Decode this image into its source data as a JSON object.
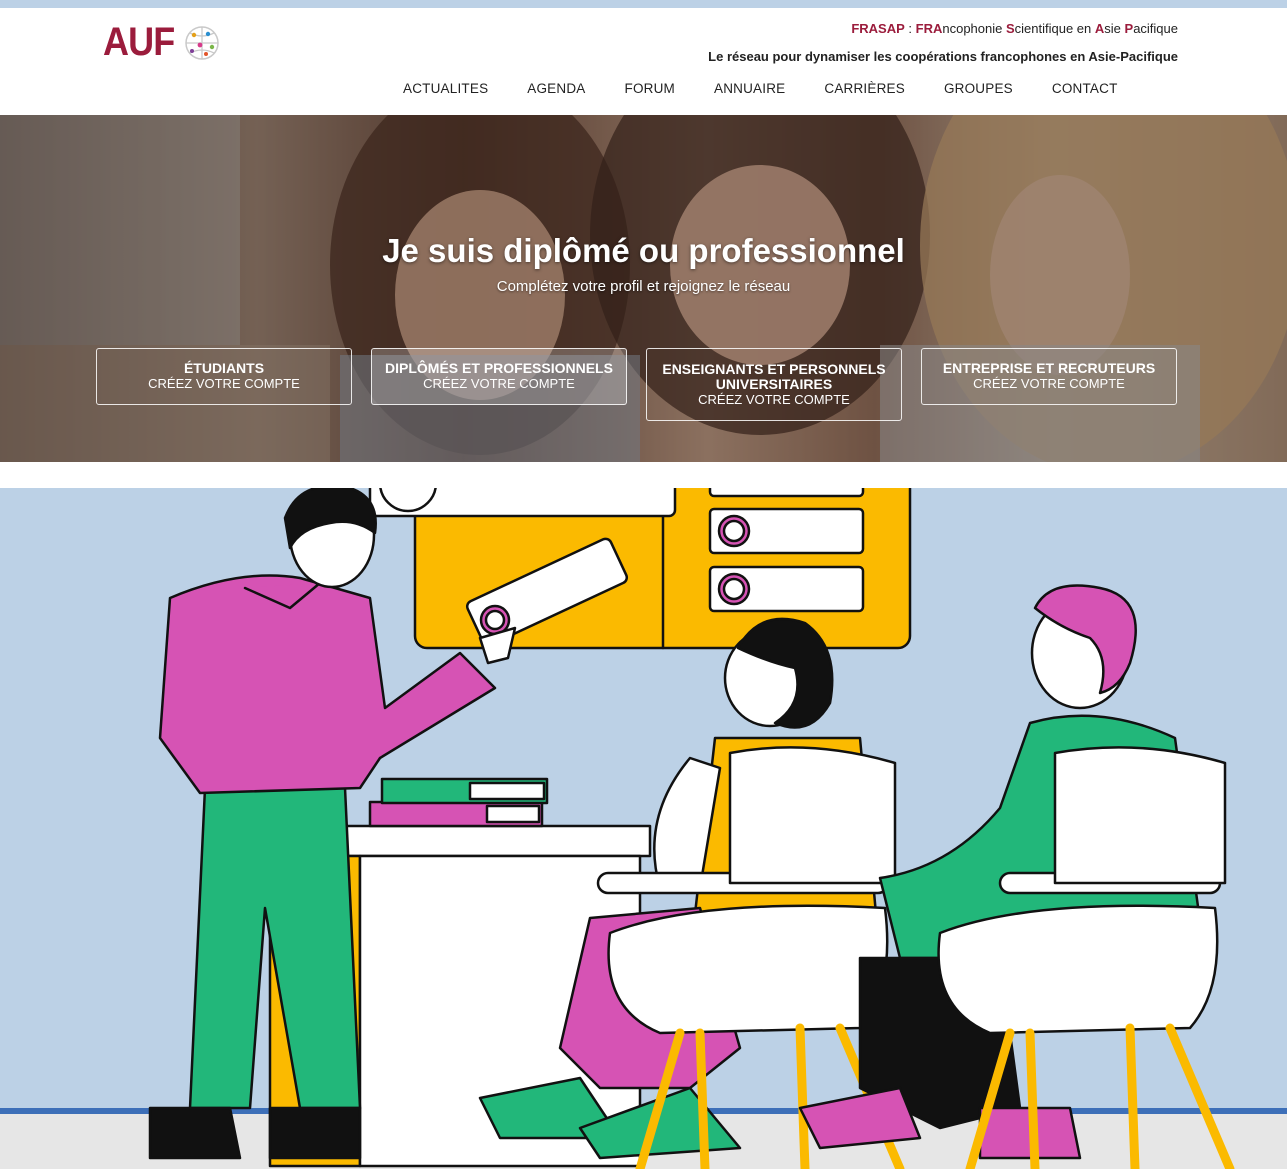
{
  "logo": {
    "text": "AUF"
  },
  "header": {
    "tagline_prefix": "FRASAP",
    "tagline_sep": " : ",
    "tagline_parts": [
      {
        "t": "FRA",
        "r": true
      },
      {
        "t": "ncophonie ",
        "r": false
      },
      {
        "t": "S",
        "r": true
      },
      {
        "t": "cientifique en ",
        "r": false
      },
      {
        "t": "A",
        "r": true
      },
      {
        "t": "sie ",
        "r": false
      },
      {
        "t": "P",
        "r": true
      },
      {
        "t": "acifique",
        "r": false
      }
    ],
    "subtitle": "Le réseau pour dynamiser les coopérations francophones en Asie-Pacifique"
  },
  "nav": [
    "ACTUALITES",
    "AGENDA",
    "FORUM",
    "ANNUAIRE",
    "CARRIÈRES",
    "GROUPES",
    "CONTACT"
  ],
  "hero": {
    "title": "Je suis diplômé ou professionnel",
    "subtitle": "Complétez votre profil et rejoignez le réseau",
    "cards": [
      {
        "title": "ÉTUDIANTS",
        "sub": "CRÉEZ VOTRE COMPTE"
      },
      {
        "title": "DIPLÔMÉS ET PROFESSIONNELS",
        "sub": "CRÉEZ VOTRE COMPTE"
      },
      {
        "title": "ENSEIGNANTS ET PERSONNELS UNIVERSITAIRES",
        "sub": "CRÉEZ VOTRE COMPTE"
      },
      {
        "title": "ENTREPRISE ET RECRUTEURS",
        "sub": "CRÉEZ VOTRE COMPTE"
      }
    ]
  },
  "colors": {
    "brand": "#9b1c3c",
    "yellow": "#fbba00",
    "pink": "#d653b4",
    "green": "#22b77a",
    "sky": "#bcd1e6"
  }
}
